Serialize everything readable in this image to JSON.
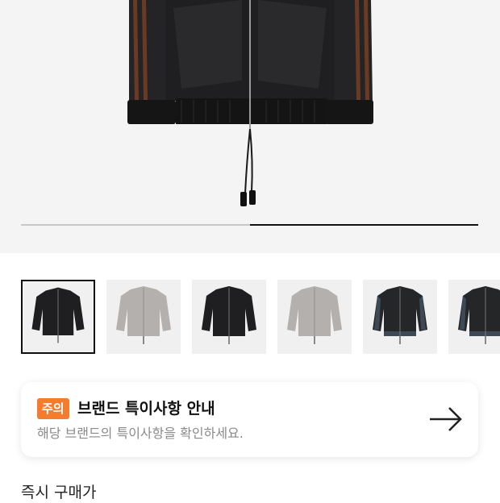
{
  "gallery": {
    "progress_fraction": 0.5,
    "product_colors": {
      "black": "#1f1f21",
      "brown_stripe": "#6a3a22",
      "grey": "#b3b0ad",
      "velour": "#252628"
    }
  },
  "thumbnails": [
    {
      "variant": "black",
      "selected": true
    },
    {
      "variant": "grey",
      "selected": false
    },
    {
      "variant": "black",
      "selected": false
    },
    {
      "variant": "grey",
      "selected": false
    },
    {
      "variant": "velour",
      "selected": false
    },
    {
      "variant": "velour",
      "selected": false
    }
  ],
  "notice": {
    "badge": "주의",
    "title": "브랜드 특이사항 안내",
    "description": "해당 브랜드의 특이사항을 확인하세요.",
    "badge_color": "#f47c2c",
    "icon": "arrow-right-icon"
  },
  "price_section": {
    "title": "즉시 구매가"
  }
}
